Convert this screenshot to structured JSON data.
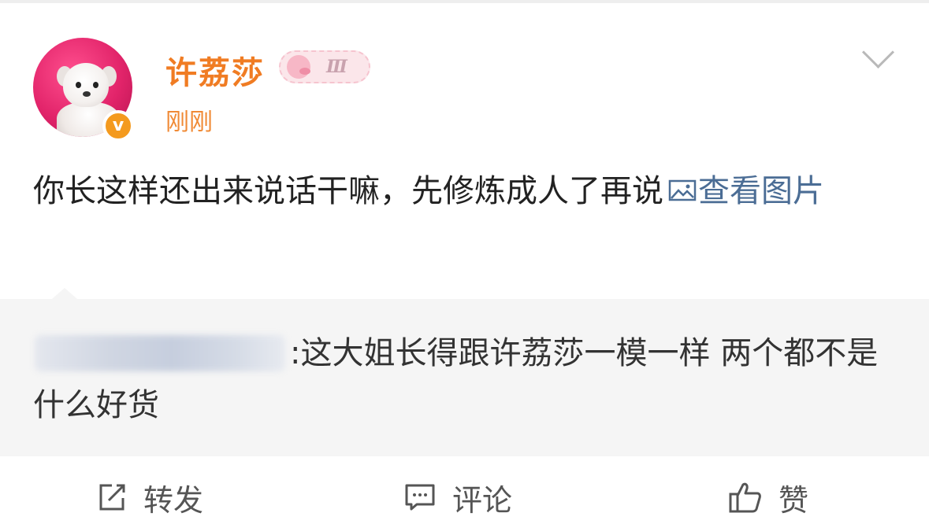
{
  "post": {
    "username": "许荔莎",
    "member_level": "Ⅲ",
    "timestamp": "刚刚",
    "verified_mark": "v",
    "text": "你长这样还出来说话干嘛，先修炼成人了再说",
    "view_image_label": "查看图片",
    "menu_icon": "chevron-down-icon"
  },
  "repost": {
    "text": ":这大姐长得跟许荔莎一模一样 两个都不是什么好货"
  },
  "actions": {
    "repost_label": "转发",
    "comment_label": "评论",
    "like_label": "赞"
  },
  "colors": {
    "username": "#f07c23",
    "link": "#4b6d95",
    "repost_bg": "#f5f5f5",
    "verified_badge": "#f49a1e"
  }
}
